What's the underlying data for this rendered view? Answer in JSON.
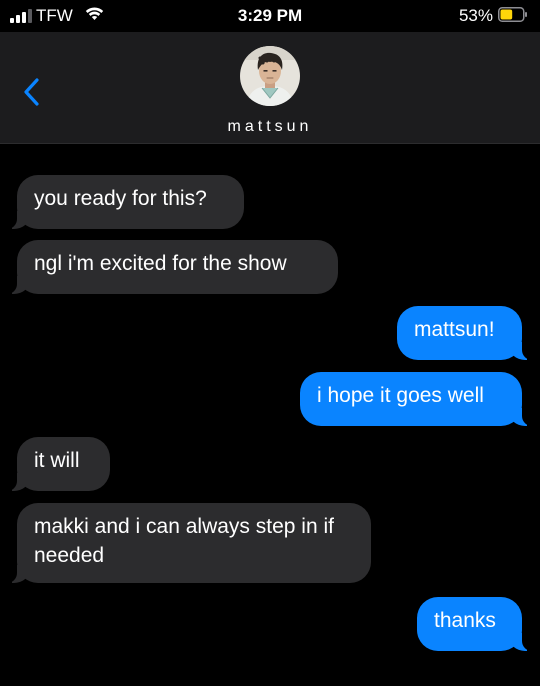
{
  "status_bar": {
    "carrier": "TFW",
    "time": "3:29 PM",
    "battery_percent": "53%",
    "battery_level": 0.53,
    "battery_color": "#ffd60a",
    "signal_icon": "signal-bars-icon",
    "wifi_icon": "wifi-icon"
  },
  "header": {
    "contact_name": "mattsun",
    "back_icon": "chevron-left-icon",
    "accent_color": "#0a84ff"
  },
  "messages": [
    {
      "direction": "received",
      "text": "you ready for this?"
    },
    {
      "direction": "received",
      "text": "ngl i'm excited for the show"
    },
    {
      "direction": "sent",
      "text": "mattsun!"
    },
    {
      "direction": "sent",
      "text": "i hope it goes well"
    },
    {
      "direction": "received",
      "text": "it will"
    },
    {
      "direction": "received",
      "text": "makki and i can always step in if needed"
    },
    {
      "direction": "sent",
      "text": "thanks"
    }
  ],
  "colors": {
    "received_bubble": "#2c2c2e",
    "sent_bubble": "#0a84ff",
    "header_bg": "#1c1c1e"
  }
}
